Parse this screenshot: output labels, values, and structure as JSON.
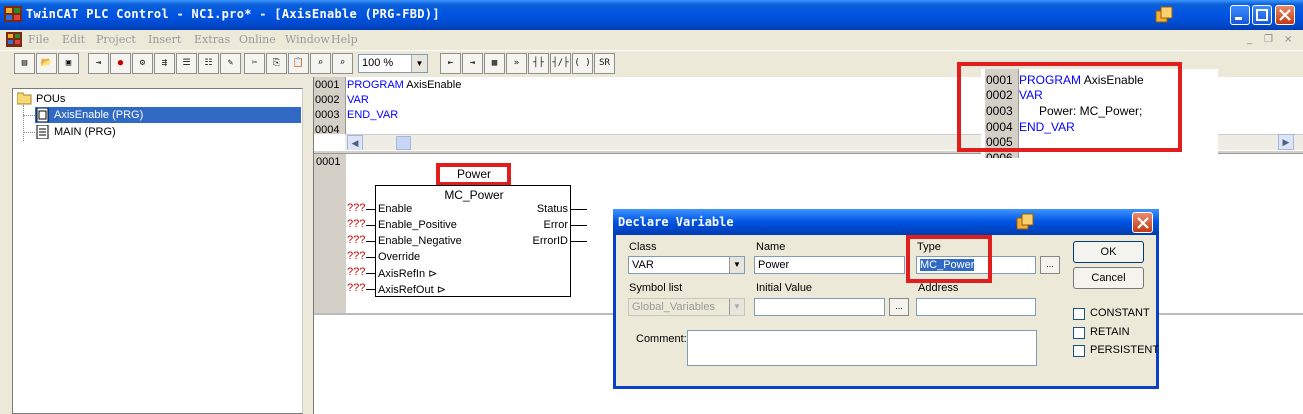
{
  "window": {
    "title": "TwinCAT PLC Control - NC1.pro* - [AxisEnable (PRG-FBD)]"
  },
  "menu": {
    "items": [
      "File",
      "Edit",
      "Project",
      "Insert",
      "Extras",
      "Online",
      "Window",
      "Help"
    ]
  },
  "toolbar": {
    "zoom": "100 %"
  },
  "tree": {
    "root": "POUs",
    "items": [
      "AxisEnable (PRG)",
      "MAIN (PRG)"
    ],
    "selected_index": 0
  },
  "declaration": {
    "lines": [
      {
        "num": "0001",
        "kw": "PROGRAM",
        "rest": " AxisEnable"
      },
      {
        "num": "0002",
        "kw": "VAR",
        "rest": ""
      },
      {
        "num": "0003",
        "kw": "END_VAR",
        "rest": ""
      },
      {
        "num": "0004",
        "kw": "",
        "rest": ""
      }
    ]
  },
  "zoom_inset": {
    "lines": [
      {
        "num": "0001",
        "kw": "PROGRAM",
        "rest": " AxisEnable"
      },
      {
        "num": "0002",
        "kw": "VAR",
        "rest": ""
      },
      {
        "num": "0003",
        "kw": "",
        "rest": "Power: MC_Power;"
      },
      {
        "num": "0004",
        "kw": "END_VAR",
        "rest": ""
      },
      {
        "num": "0005",
        "kw": "",
        "rest": ""
      },
      {
        "num": "0006",
        "kw": "",
        "rest": ""
      }
    ]
  },
  "fbd": {
    "network_number": "0001",
    "instance_name": "Power",
    "block_type": "MC_Power",
    "inputs": [
      "Enable",
      "Enable_Positive",
      "Enable_Negative",
      "Override",
      "AxisRefIn",
      "AxisRefOut"
    ],
    "input_markers": [
      "",
      "",
      "",
      "",
      "⊳",
      "⊳"
    ],
    "outputs": [
      "Status",
      "Error",
      "ErrorID"
    ],
    "placeholder": "???"
  },
  "dialog": {
    "title": "Declare Variable",
    "class_label": "Class",
    "class_value": "VAR",
    "name_label": "Name",
    "name_value": "Power",
    "type_label": "Type",
    "type_value": "MC_Power",
    "type_browse": "...",
    "symbol_label": "Symbol list",
    "symbol_value": "Global_Variables",
    "initial_label": "Initial Value",
    "initial_value": "",
    "initial_browse": "...",
    "address_label": "Address",
    "address_value": "",
    "comment_label": "Comment:",
    "comment_value": "",
    "ok_label": "OK",
    "cancel_label": "Cancel",
    "checkboxes": [
      "CONSTANT",
      "RETAIN",
      "PERSISTENT"
    ]
  },
  "colors": {
    "keyword": "#0000ff",
    "highlight_box": "#e01e1e",
    "placeholder": "#d00000",
    "titlebar": "#0054e3"
  }
}
